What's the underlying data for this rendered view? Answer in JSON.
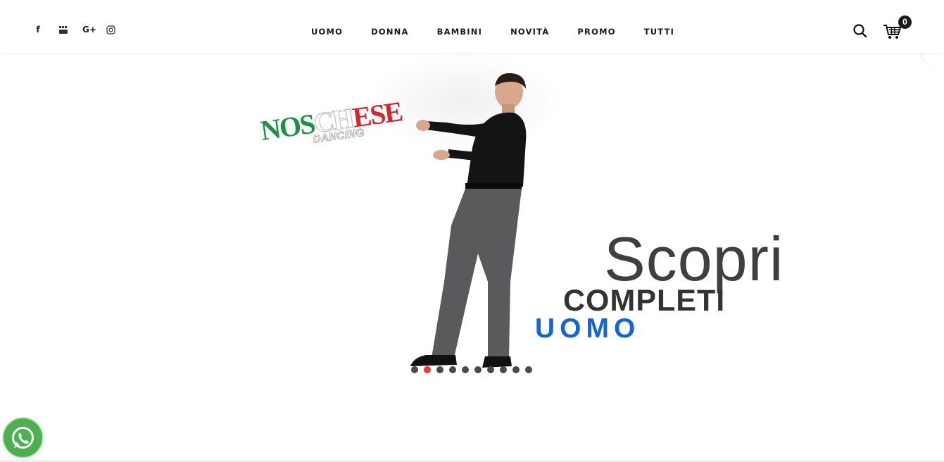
{
  "header": {
    "social": [
      {
        "name": "facebook-icon",
        "glyph": "f"
      },
      {
        "name": "youtube-icon",
        "glyph": "▶"
      },
      {
        "name": "google-plus-icon",
        "glyph": "G+"
      },
      {
        "name": "instagram-icon",
        "glyph": "◎"
      }
    ],
    "nav": [
      {
        "label": "UOMO"
      },
      {
        "label": "DONNA"
      },
      {
        "label": "BAMBINI"
      },
      {
        "label": "NOVITÀ"
      },
      {
        "label": "PROMO"
      },
      {
        "label": "TUTTI"
      }
    ],
    "search_icon": "search-icon",
    "cart_icon": "cart-icon",
    "cart_count": "0"
  },
  "hero": {
    "logo": {
      "part_green": "NOS",
      "part_white": "CH",
      "part_red": "ESE",
      "sub": "DANCING"
    },
    "headline": "Scopri",
    "subheadline": "COMPLETI",
    "category": "UOMO",
    "slider": {
      "total": 10,
      "active_index": 1
    }
  },
  "floating": {
    "whatsapp_icon": "whatsapp-icon"
  },
  "colors": {
    "accent_blue": "#1266d8",
    "dot_active": "#e63b2e",
    "dot_inactive": "#4a4a4a",
    "whatsapp_green": "#4caf50",
    "logo_green": "#1e9148",
    "logo_red": "#d6262c"
  }
}
